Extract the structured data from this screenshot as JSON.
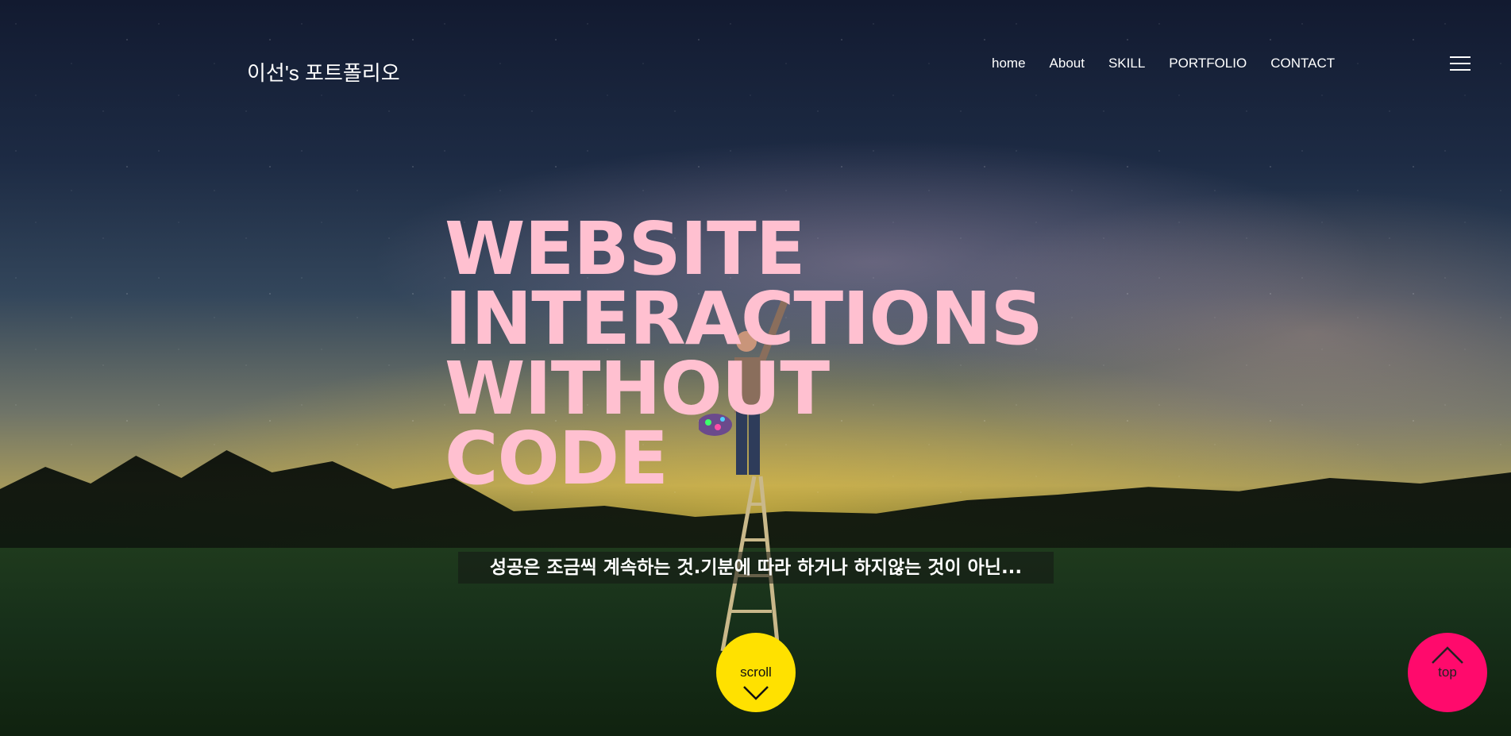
{
  "header": {
    "logo_text": "이선's 포트폴리오",
    "nav_items": [
      "home",
      "About",
      "SKILL",
      "PORTFOLIO",
      "CONTACT"
    ],
    "menu_icon": "hamburger-menu-icon"
  },
  "hero": {
    "headline_lines": [
      "WEBSITE",
      "INTERACTIONS",
      "WITHOUT",
      "CODE"
    ],
    "quote": "성공은 조금씩 계속하는 것.기분에 따라 하거나 하지않는 것이 아닌...",
    "headline_color": "#ffc0d0"
  },
  "buttons": {
    "scroll_label": "scroll",
    "scroll_icon": "chevron-down-icon",
    "scroll_color": "#ffe100",
    "top_label": "top",
    "top_icon": "chevron-up-icon",
    "top_color": "#ff0a6c"
  }
}
